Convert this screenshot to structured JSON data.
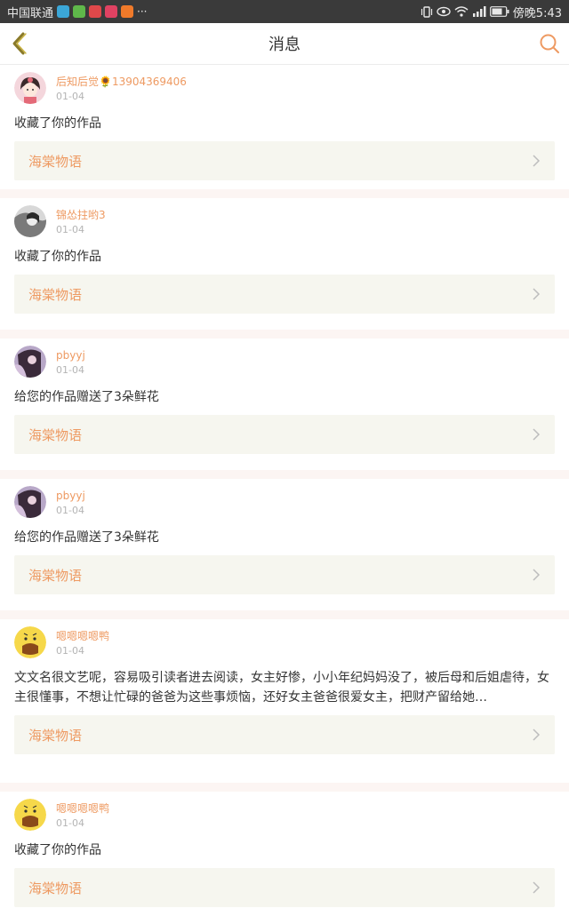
{
  "status_bar": {
    "carrier": "中国联通",
    "time": "傍晚5:43",
    "more": "···"
  },
  "header": {
    "title": "消息"
  },
  "notifications": [
    {
      "username": "后知后觉🌻13904369406",
      "date": "01-04",
      "message": "收藏了你的作品",
      "work": "海棠物语"
    },
    {
      "username": "锦怂拄哟3",
      "date": "01-04",
      "message": "收藏了你的作品",
      "work": "海棠物语"
    },
    {
      "username": "pbyyj",
      "date": "01-04",
      "message": "给您的作品赠送了3朵鲜花",
      "work": "海棠物语"
    },
    {
      "username": "pbyyj",
      "date": "01-04",
      "message": "给您的作品赠送了3朵鲜花",
      "work": "海棠物语"
    },
    {
      "username": "嗯嗯嗯嗯鸭",
      "date": "01-04",
      "message": "文文名很文艺呢，容易吸引读者进去阅读，女主好惨，小小年纪妈妈没了，被后母和后姐虐待，女主很懂事，不想让忙碌的爸爸为这些事烦恼，还好女主爸爸很爱女主，把财产留给她…",
      "work": "海棠物语"
    },
    {
      "username": "嗯嗯嗯嗯鸭",
      "date": "01-04",
      "message": "收藏了你的作品",
      "work": "海棠物语"
    }
  ],
  "colors": {
    "accent": "#ee9a62",
    "card_bg": "#f6f6ef",
    "separator": "#fcf5f3"
  }
}
